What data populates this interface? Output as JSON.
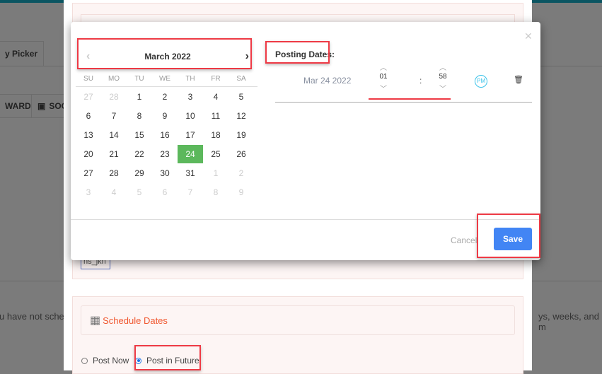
{
  "background": {
    "tab_picker": "y Picker",
    "tab_forward": "WARD",
    "tab_soc": "SOC",
    "notice_left": "u have not sche",
    "notice_right": "ys, weeks, and m",
    "tag": "ns_jkn"
  },
  "schedule": {
    "title": "Schedule Dates",
    "icon": "calendar-icon",
    "post_now": "Post Now",
    "post_future": "Post in Future",
    "selected": "Post in Future"
  },
  "dialog": {
    "close_icon": "close-icon",
    "calendar": {
      "month_label": "March 2022",
      "prev": "‹",
      "next": "›",
      "weekdays": [
        "SU",
        "MO",
        "TU",
        "WE",
        "TH",
        "FR",
        "SA"
      ],
      "weeks": [
        [
          "27",
          "28",
          "1",
          "2",
          "3",
          "4",
          "5"
        ],
        [
          "6",
          "7",
          "8",
          "9",
          "10",
          "11",
          "12"
        ],
        [
          "13",
          "14",
          "15",
          "16",
          "17",
          "18",
          "19"
        ],
        [
          "20",
          "21",
          "22",
          "23",
          "24",
          "25",
          "26"
        ],
        [
          "27",
          "28",
          "29",
          "30",
          "31",
          "1",
          "2"
        ],
        [
          "3",
          "4",
          "5",
          "6",
          "7",
          "8",
          "9"
        ]
      ],
      "selected_day": "24",
      "selected_color": "#5cb85c"
    },
    "posting": {
      "label": "Posting Dates:",
      "date": "Mar 24 2022",
      "hour": "01",
      "separator": ":",
      "minute": "58",
      "meridiem": "PM"
    },
    "cancel_label": "Cancel",
    "save_label": "Save",
    "save_color": "#4285f4"
  }
}
